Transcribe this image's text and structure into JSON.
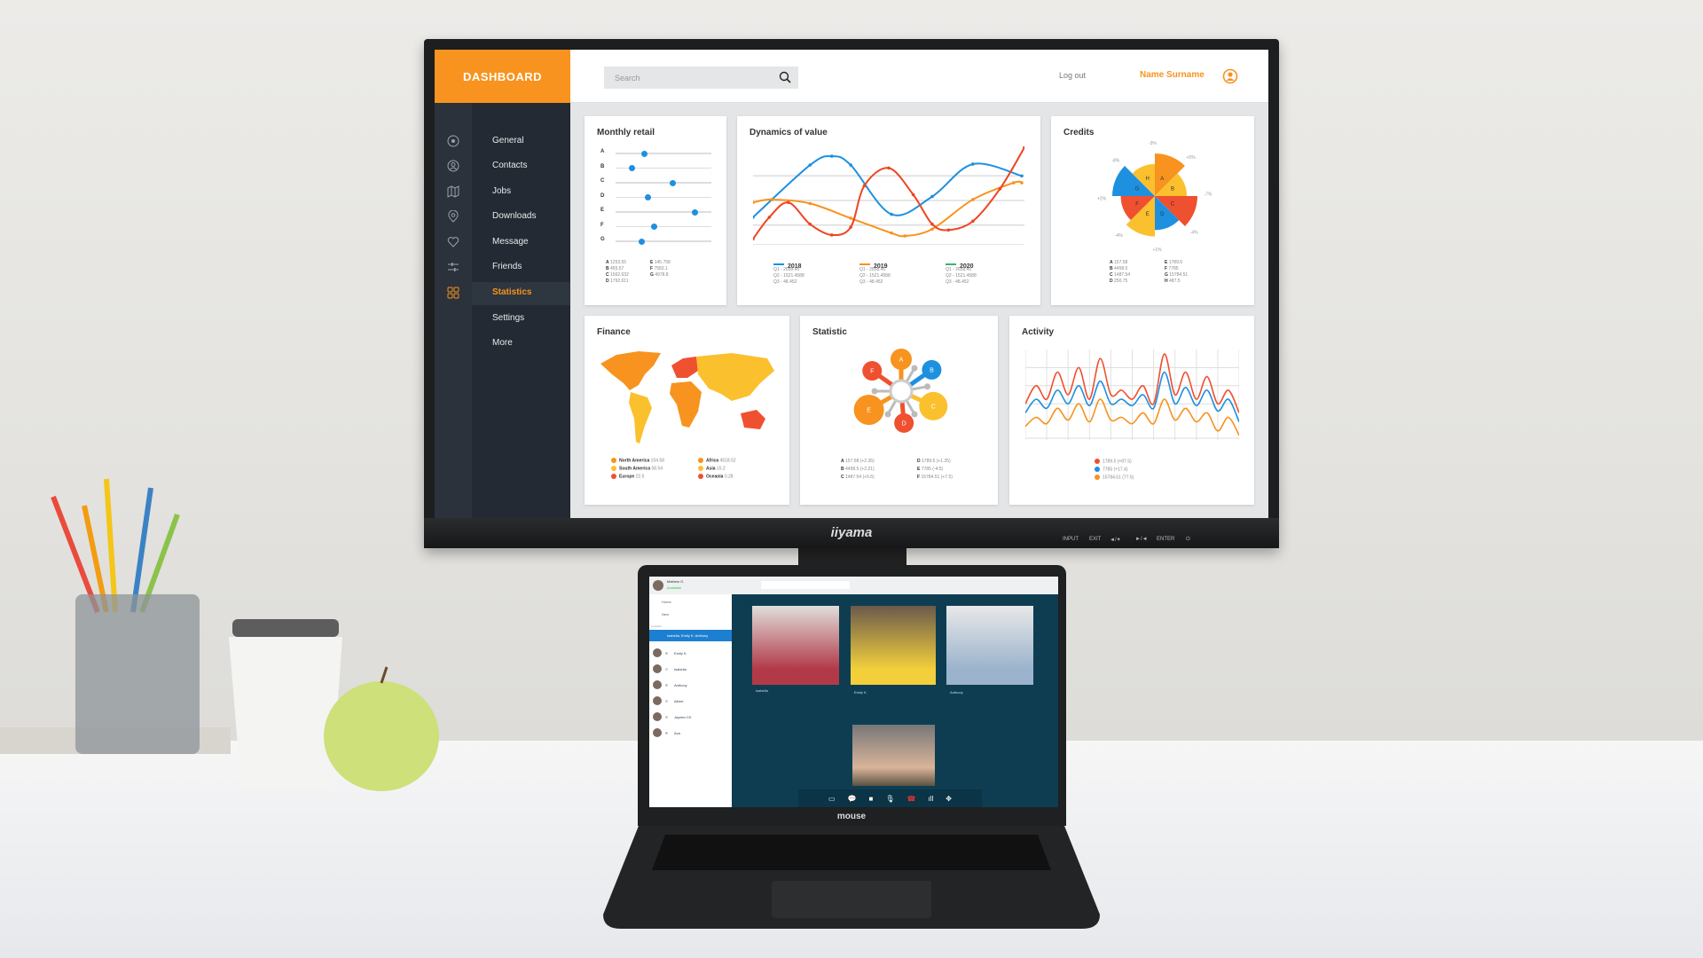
{
  "monitor": {
    "brand": "iiyama",
    "buttons": [
      "INPUT",
      "EXIT",
      "◄/✦",
      "►/◄",
      "ENTER",
      "⏻"
    ]
  },
  "dashboard": {
    "logo": "DASHBOARD",
    "search_placeholder": "Search",
    "logout": "Log out",
    "user_name": "Name Surname",
    "accent": "#f7931e",
    "sidebar": [
      {
        "label": "General",
        "icon": "target-icon"
      },
      {
        "label": "Contacts",
        "icon": "user-circle-icon"
      },
      {
        "label": "Jobs",
        "icon": "map-icon"
      },
      {
        "label": "Downloads",
        "icon": "location-pin-icon"
      },
      {
        "label": "Message",
        "icon": "heart-icon"
      },
      {
        "label": "Friends",
        "icon": "sliders-icon"
      },
      {
        "label": "Statistics",
        "icon": "grid-icon",
        "active": true
      },
      {
        "label": "Settings"
      },
      {
        "label": "More"
      }
    ],
    "monthly_retail": {
      "title": "Monthly retail",
      "sliders": [
        {
          "label": "A",
          "value": 0.3
        },
        {
          "label": "B",
          "value": 0.17
        },
        {
          "label": "C",
          "value": 0.59
        },
        {
          "label": "D",
          "value": 0.33
        },
        {
          "label": "E",
          "value": 0.82
        },
        {
          "label": "F",
          "value": 0.4
        },
        {
          "label": "G",
          "value": 0.27
        }
      ],
      "legend": [
        [
          "A",
          "1253.55"
        ],
        [
          "B",
          "455.57"
        ],
        [
          "C",
          "1562.632"
        ],
        [
          "D",
          "1792.611"
        ],
        [
          "E",
          "145.758"
        ],
        [
          "F",
          "7583.1"
        ],
        [
          "G",
          "4978.8"
        ]
      ]
    },
    "dynamics": {
      "title": "Dynamics of value",
      "series": [
        {
          "name": "2018",
          "color": "#1e90e0",
          "lines": [
            "Q1 - 2658.45",
            "Q2 - 1521.4588",
            "Q3 - 48.452"
          ],
          "points": [
            [
              0,
              28
            ],
            [
              21,
              81
            ],
            [
              29,
              90
            ],
            [
              36,
              81
            ],
            [
              51,
              31
            ],
            [
              66,
              49
            ],
            [
              81,
              82
            ],
            [
              99,
              70
            ]
          ]
        },
        {
          "name": "2019",
          "color": "#f7931e",
          "lines": [
            "Q1 - 2658.45",
            "Q2 - 1521.4588",
            "Q3 - 48.452"
          ],
          "points": [
            [
              0,
              43
            ],
            [
              7,
              46
            ],
            [
              21,
              42
            ],
            [
              36,
              27
            ],
            [
              51,
              12
            ],
            [
              56,
              9
            ],
            [
              66,
              16
            ],
            [
              81,
              46
            ],
            [
              96,
              63
            ],
            [
              99,
              63
            ]
          ]
        },
        {
          "name": "2020",
          "color": "#3cb371",
          "lines": [
            "Q1 - 2658.45",
            "Q2 - 1521.4588",
            "Q3 - 48.452"
          ],
          "points": [
            [
              0,
              6
            ],
            [
              6,
              28
            ],
            [
              13,
              43
            ],
            [
              21,
              21
            ],
            [
              29,
              10
            ],
            [
              36,
              18
            ],
            [
              41,
              60
            ],
            [
              50,
              78
            ],
            [
              59,
              51
            ],
            [
              66,
              21
            ],
            [
              72,
              15
            ],
            [
              81,
              24
            ],
            [
              91,
              57
            ],
            [
              100,
              99
            ]
          ],
          "draw_color": "#ee4422"
        }
      ]
    },
    "credits": {
      "title": "Credits",
      "segments": [
        {
          "label": "A",
          "value": 1.0,
          "color": "#f7931e",
          "delta": "+5%"
        },
        {
          "label": "B",
          "value": 0.75,
          "color": "#fbc02d",
          "delta": "-7%"
        },
        {
          "label": "C",
          "value": 1.0,
          "color": "#ef5030",
          "delta": "-4%"
        },
        {
          "label": "D",
          "value": 0.8,
          "color": "#1e90e0",
          "delta": "+1%"
        },
        {
          "label": "E",
          "value": 0.95,
          "color": "#fbc02d",
          "delta": "-4%"
        },
        {
          "label": "F",
          "value": 0.8,
          "color": "#ef5030",
          "delta": "+2%"
        },
        {
          "label": "G",
          "value": 1.0,
          "color": "#1e90e0",
          "delta": "-8%"
        },
        {
          "label": "H",
          "value": 0.75,
          "color": "#fbc02d",
          "delta": "-3%"
        }
      ],
      "legend": [
        [
          "A",
          "157.58"
        ],
        [
          "B",
          "4458.5"
        ],
        [
          "C",
          "1487.54"
        ],
        [
          "D",
          "250.75"
        ],
        [
          "E",
          "1789.5"
        ],
        [
          "F",
          "7785"
        ],
        [
          "G",
          "15784.51"
        ],
        [
          "H",
          "487.5"
        ]
      ]
    },
    "finance": {
      "title": "Finance",
      "legend": [
        {
          "name": "North America",
          "value": "104.58",
          "color": "#f7931e"
        },
        {
          "name": "South America",
          "value": "58.54",
          "color": "#fbc02d"
        },
        {
          "name": "Europe",
          "value": "22.5",
          "color": "#ef5030"
        },
        {
          "name": "Africa",
          "value": "4518.52",
          "color": "#f7931e"
        },
        {
          "name": "Asia",
          "value": "15.2",
          "color": "#fbc02d"
        },
        {
          "name": "Oceania",
          "value": "0.28",
          "color": "#ef5030"
        }
      ]
    },
    "statistic": {
      "title": "Statistic",
      "petals": [
        {
          "label": "A",
          "color": "#f7931e",
          "angle": -90
        },
        {
          "label": "B",
          "color": "#1e90e0",
          "angle": -35
        },
        {
          "label": "C",
          "color": "#fbc02d",
          "angle": 25
        },
        {
          "label": "D",
          "color": "#ef5030",
          "angle": 85
        },
        {
          "label": "E",
          "color": "#f7931e",
          "angle": 150
        },
        {
          "label": "F",
          "color": "#ef5030",
          "angle": -145
        }
      ],
      "legend": [
        [
          "A",
          "157.58 (+2.35)"
        ],
        [
          "B",
          "4458.5 (+2.21)"
        ],
        [
          "C",
          "1487.54 (+5.6)"
        ],
        [
          "D",
          "1789.5 (+1.25)"
        ],
        [
          "E",
          "7785 (-4.5)"
        ],
        [
          "F",
          "15784.51 (+7.5)"
        ]
      ]
    },
    "activity": {
      "title": "Activity",
      "series": [
        {
          "color": "#ef5030",
          "label": "1789.5 (+87.5)",
          "values": [
            40,
            60,
            45,
            75,
            50,
            80,
            45,
            90,
            50,
            55,
            45,
            60,
            40,
            95,
            50,
            75,
            45,
            70,
            40,
            55,
            30
          ]
        },
        {
          "color": "#1e90e0",
          "label": "7785 (+17.4)",
          "values": [
            30,
            45,
            35,
            55,
            40,
            60,
            38,
            65,
            40,
            45,
            38,
            50,
            35,
            75,
            40,
            58,
            38,
            55,
            32,
            45,
            20
          ]
        },
        {
          "color": "#f7931e",
          "label": "15784.51 (77.5)",
          "values": [
            15,
            25,
            18,
            35,
            22,
            40,
            20,
            45,
            22,
            25,
            18,
            30,
            18,
            45,
            22,
            35,
            20,
            30,
            10,
            25,
            5
          ]
        }
      ]
    }
  },
  "laptop": {
    "brand": "mouse",
    "user": "Mathew O.",
    "status": "Available",
    "nav": [
      "Home",
      "New"
    ],
    "section": "Contacts",
    "active_chat": "Isabella, Emily K, Anthony",
    "contacts": [
      {
        "name": "Emily K.",
        "status": "#2ecc40"
      },
      {
        "name": "Isabella",
        "status": "#ffffff"
      },
      {
        "name": "Anthony",
        "status": "#2ecc40"
      },
      {
        "name": "Albert",
        "status": "#f4b6c2"
      },
      {
        "name": "Jayden CK",
        "status": "#f1c40f"
      },
      {
        "name": "Ava",
        "status": "#e74c3c"
      }
    ],
    "participants": [
      "Isabella",
      "Emily K.",
      "Anthony"
    ]
  }
}
